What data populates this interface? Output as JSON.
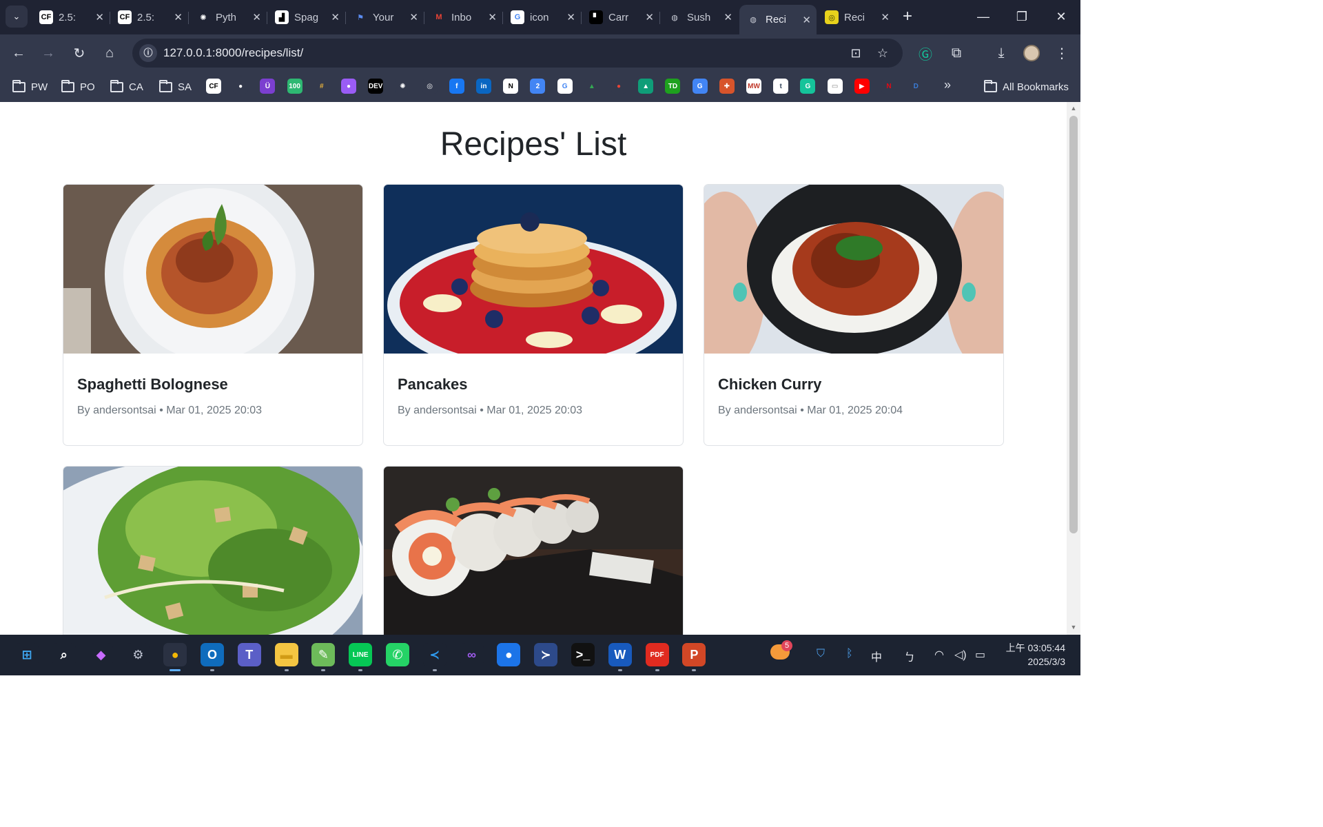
{
  "browser": {
    "tabs": [
      {
        "title": "2.5:",
        "favicon": "cf-icon",
        "active": false
      },
      {
        "title": "2.5:",
        "favicon": "cf-icon",
        "active": false
      },
      {
        "title": "Pyth",
        "favicon": "openai-icon",
        "active": false
      },
      {
        "title": "Spag",
        "favicon": "app-icon",
        "active": false
      },
      {
        "title": "Your",
        "favicon": "flag-icon",
        "active": false
      },
      {
        "title": "Inbo",
        "favicon": "gmail-icon",
        "active": false
      },
      {
        "title": "icon",
        "favicon": "google-icon",
        "active": false
      },
      {
        "title": "Carr",
        "favicon": "dark-square-icon",
        "active": false
      },
      {
        "title": "Sush",
        "favicon": "globe-icon",
        "active": false
      },
      {
        "title": "Reci",
        "favicon": "globe-icon",
        "active": true
      },
      {
        "title": "Reci",
        "favicon": "spiral-icon",
        "active": false
      }
    ],
    "url": "127.0.0.1:8000/recipes/list/",
    "bookmark_folders": [
      "PW",
      "PO",
      "CA",
      "SA"
    ],
    "bookmarks_all_label": "All Bookmarks",
    "bookmark_icons": [
      {
        "name": "cf-icon",
        "text": "CF",
        "color": "#ffffff",
        "fg": "#000000"
      },
      {
        "name": "github-icon",
        "text": "●",
        "color": "#33394c",
        "fg": "#ffffff"
      },
      {
        "name": "udemy-icon",
        "text": "Ü",
        "color": "#7b3fd0",
        "fg": "#ffffff"
      },
      {
        "name": "100-icon",
        "text": "100",
        "color": "#2eb872",
        "fg": "#ffffff"
      },
      {
        "name": "slack-icon",
        "text": "#",
        "color": "#33394c",
        "fg": "#e8b23c"
      },
      {
        "name": "messenger-icon",
        "text": "●",
        "color": "#9a5cf5",
        "fg": "#ffffff"
      },
      {
        "name": "dev-icon",
        "text": "DEV",
        "color": "#000000",
        "fg": "#ffffff"
      },
      {
        "name": "openai-icon",
        "text": "✺",
        "color": "#33394c",
        "fg": "#ffffff"
      },
      {
        "name": "podcast-icon",
        "text": "◎",
        "color": "#33394c",
        "fg": "#ffffff"
      },
      {
        "name": "facebook-icon",
        "text": "f",
        "color": "#1877f2",
        "fg": "#ffffff"
      },
      {
        "name": "linkedin-icon",
        "text": "in",
        "color": "#0a66c2",
        "fg": "#ffffff"
      },
      {
        "name": "notion-icon",
        "text": "N",
        "color": "#ffffff",
        "fg": "#000000"
      },
      {
        "name": "calendar-icon",
        "text": "2",
        "color": "#4285f4",
        "fg": "#ffffff"
      },
      {
        "name": "google-icon",
        "text": "G",
        "color": "#ffffff",
        "fg": "#4285f4"
      },
      {
        "name": "drive-icon",
        "text": "▲",
        "color": "#33394c",
        "fg": "#34a853"
      },
      {
        "name": "maps-icon",
        "text": "●",
        "color": "#33394c",
        "fg": "#ea4335"
      },
      {
        "name": "app-teal-icon",
        "text": "▲",
        "color": "#0f9d78",
        "fg": "#ffffff"
      },
      {
        "name": "td-icon",
        "text": "TD",
        "color": "#1ea11e",
        "fg": "#ffffff"
      },
      {
        "name": "translate-icon",
        "text": "G",
        "color": "#4285f4",
        "fg": "#ffffff"
      },
      {
        "name": "crest-icon",
        "text": "✚",
        "color": "#d7542b",
        "fg": "#ffffff"
      },
      {
        "name": "mw-icon",
        "text": "MW",
        "color": "#ffffff",
        "fg": "#c0392b"
      },
      {
        "name": "tumblr-icon",
        "text": "t",
        "color": "#ffffff",
        "fg": "#35465c"
      },
      {
        "name": "grammarly-icon",
        "text": "G",
        "color": "#15c39a",
        "fg": "#ffffff"
      },
      {
        "name": "white-app-icon",
        "text": "▭",
        "color": "#ffffff",
        "fg": "#888888"
      },
      {
        "name": "youtube-icon",
        "text": "▶",
        "color": "#ff0000",
        "fg": "#ffffff"
      },
      {
        "name": "netflix-icon",
        "text": "N",
        "color": "#33394c",
        "fg": "#e50914"
      },
      {
        "name": "d-icon",
        "text": "D",
        "color": "#33394c",
        "fg": "#3a7bd5"
      }
    ]
  },
  "page": {
    "title": "Recipes' List",
    "recipes": [
      {
        "title": "Spaghetti Bolognese",
        "author": "By andersontsai",
        "sep": "•",
        "date": "Mar 01, 2025 20:03",
        "image": "spaghetti-image"
      },
      {
        "title": "Pancakes",
        "author": "By andersontsai",
        "sep": "•",
        "date": "Mar 01, 2025 20:03",
        "image": "pancakes-image"
      },
      {
        "title": "Chicken Curry",
        "author": "By andersontsai",
        "sep": "•",
        "date": "Mar 01, 2025 20:04",
        "image": "curry-image"
      },
      {
        "title": "",
        "author": "",
        "sep": "",
        "date": "",
        "image": "salad-image"
      },
      {
        "title": "",
        "author": "",
        "sep": "",
        "date": "",
        "image": "sushi-image"
      }
    ]
  },
  "taskbar": {
    "apps": [
      {
        "name": "start-icon",
        "text": "⊞",
        "color": "#1c2331",
        "fg": "#3fa9f5"
      },
      {
        "name": "search-icon",
        "text": "⌕",
        "color": "#1c2331",
        "fg": "#ffffff"
      },
      {
        "name": "copilot-icon",
        "text": "◆",
        "color": "#1c2331",
        "fg": "#c86bff"
      },
      {
        "name": "settings-gear-icon",
        "text": "⚙",
        "color": "#1c2331",
        "fg": "#c0c6d4"
      },
      {
        "name": "chrome-icon",
        "text": "●",
        "color": "#2a3142",
        "fg": "#f2b705"
      },
      {
        "name": "outlook-icon",
        "text": "O",
        "color": "#0f6cbd",
        "fg": "#ffffff"
      },
      {
        "name": "teams-icon",
        "text": "T",
        "color": "#5b5fc7",
        "fg": "#ffffff"
      },
      {
        "name": "file-explorer-icon",
        "text": "▬",
        "color": "#f4c542",
        "fg": "#d19b16"
      },
      {
        "name": "notepad-icon",
        "text": "✎",
        "color": "#6dbb5a",
        "fg": "#ffffff"
      },
      {
        "name": "line-icon",
        "text": "LINE",
        "color": "#06c755",
        "fg": "#ffffff"
      },
      {
        "name": "whatsapp-icon",
        "text": "✆",
        "color": "#25d366",
        "fg": "#ffffff"
      },
      {
        "name": "vscode-icon",
        "text": "≺",
        "color": "#1c2331",
        "fg": "#2f9bf0"
      },
      {
        "name": "visual-studio-icon",
        "text": "∞",
        "color": "#1c2331",
        "fg": "#a15cf0"
      },
      {
        "name": "maps-pin-icon",
        "text": "●",
        "color": "#1c74e8",
        "fg": "#ffffff"
      },
      {
        "name": "powershell-icon",
        "text": "≻",
        "color": "#2d4a8a",
        "fg": "#ffffff"
      },
      {
        "name": "terminal-icon",
        "text": ">_",
        "color": "#111111",
        "fg": "#ffffff"
      },
      {
        "name": "word-icon",
        "text": "W",
        "color": "#185abd",
        "fg": "#ffffff"
      },
      {
        "name": "pdf-icon",
        "text": "PDF",
        "color": "#e02b20",
        "fg": "#ffffff"
      },
      {
        "name": "powerpoint-icon",
        "text": "P",
        "color": "#d24726",
        "fg": "#ffffff"
      }
    ],
    "weather_badge": "5",
    "ime": "中",
    "time": "上午 03:05:44",
    "date": "2025/3/3"
  }
}
